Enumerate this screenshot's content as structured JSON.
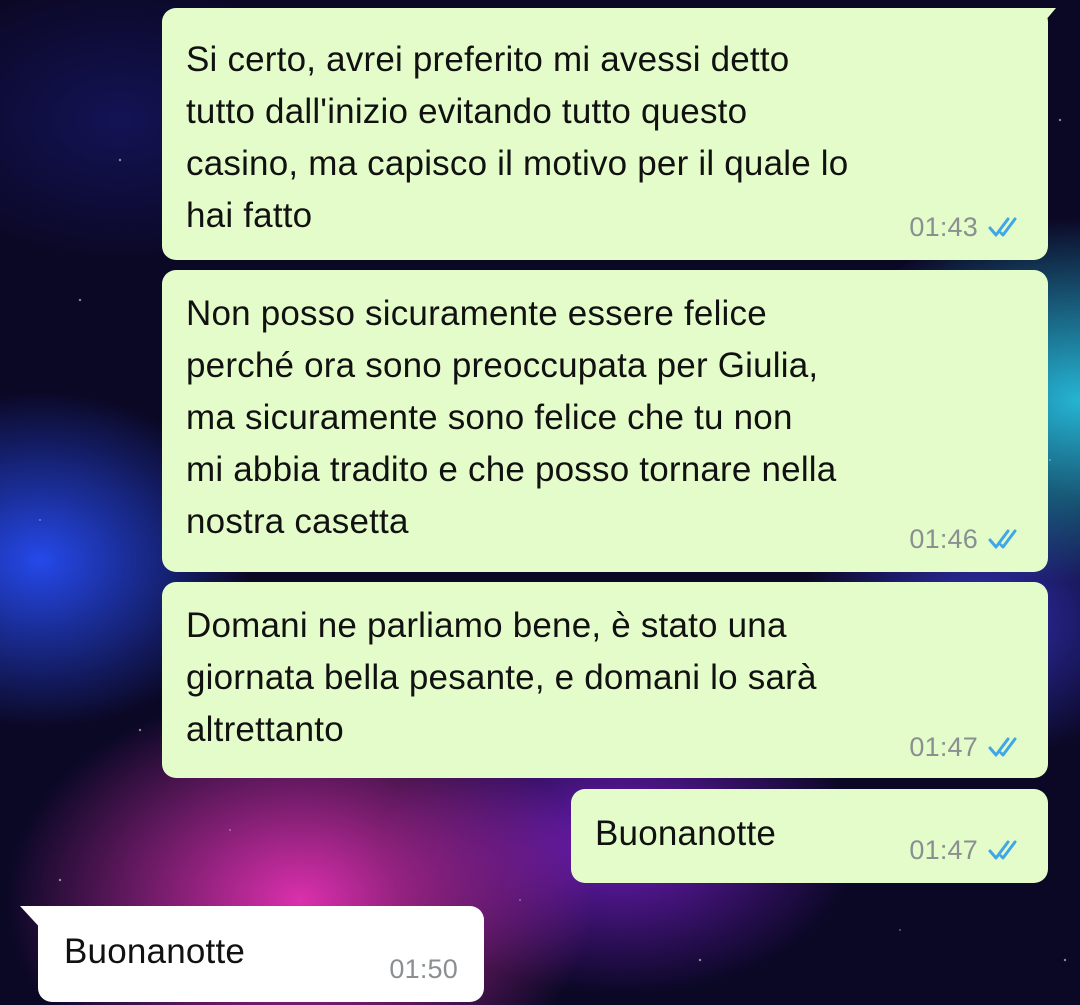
{
  "messages": [
    {
      "direction": "outgoing",
      "text": "Si certo, avrei preferito mi avessi detto\ntutto dall'inizio evitando tutto questo\ncasino, ma capisco il motivo per il quale lo\nhai fatto",
      "time": "01:43",
      "status": "read"
    },
    {
      "direction": "outgoing",
      "text": "Non posso sicuramente essere felice\nperché ora sono preoccupata per Giulia,\nma sicuramente sono felice che tu non\nmi abbia tradito e che posso tornare nella\nnostra casetta",
      "time": "01:46",
      "status": "read"
    },
    {
      "direction": "outgoing",
      "text": "Domani ne parliamo bene, è stato una\ngiornata bella pesante, e domani lo sarà\naltrettanto",
      "time": "01:47",
      "status": "read"
    },
    {
      "direction": "outgoing",
      "text": "Buonanotte",
      "time": "01:47",
      "status": "read"
    },
    {
      "direction": "incoming",
      "text": "Buonanotte",
      "time": "01:50"
    }
  ],
  "colors": {
    "outgoing_bubble": "#e4fcc9",
    "incoming_bubble": "#ffffff",
    "read_ticks": "#3fa7e8",
    "timestamp": "#8a8f92"
  },
  "icons": {
    "read_status": "double-check-icon"
  }
}
